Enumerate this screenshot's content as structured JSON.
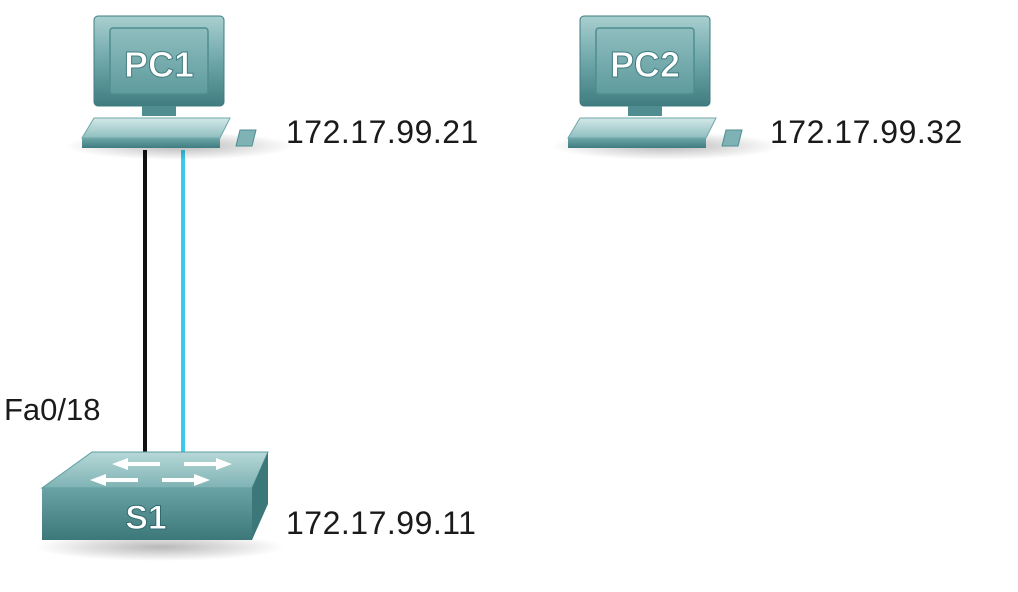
{
  "devices": {
    "pc1": {
      "name": "PC1",
      "ip": "172.17.99.21"
    },
    "pc2": {
      "name": "PC2",
      "ip": "172.17.99.32"
    },
    "s1": {
      "name": "S1",
      "ip": "172.17.99.11"
    }
  },
  "links": {
    "pc1_s1_ethernet": {
      "port": "Fa0/18",
      "color": "#111111"
    },
    "pc1_s1_console": {
      "color": "#3cc8ec"
    }
  },
  "colors": {
    "device_body": "#5c9ea0",
    "device_dark": "#3f7c80",
    "device_light": "#c7e2e2",
    "screen_face": "#6fa7a9",
    "label_text": "#ffffff"
  }
}
